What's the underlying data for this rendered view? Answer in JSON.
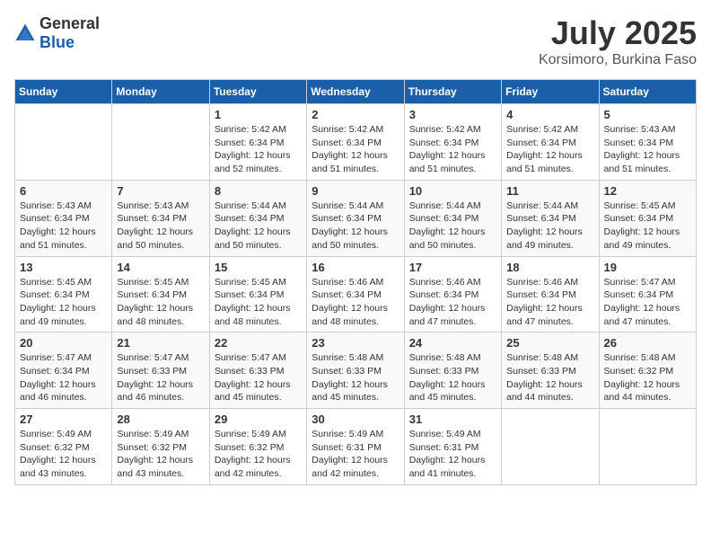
{
  "header": {
    "logo_general": "General",
    "logo_blue": "Blue",
    "month": "July 2025",
    "location": "Korsimoro, Burkina Faso"
  },
  "days_of_week": [
    "Sunday",
    "Monday",
    "Tuesday",
    "Wednesday",
    "Thursday",
    "Friday",
    "Saturday"
  ],
  "weeks": [
    [
      {
        "day": "",
        "sunrise": "",
        "sunset": "",
        "daylight": ""
      },
      {
        "day": "",
        "sunrise": "",
        "sunset": "",
        "daylight": ""
      },
      {
        "day": "1",
        "sunrise": "Sunrise: 5:42 AM",
        "sunset": "Sunset: 6:34 PM",
        "daylight": "Daylight: 12 hours and 52 minutes."
      },
      {
        "day": "2",
        "sunrise": "Sunrise: 5:42 AM",
        "sunset": "Sunset: 6:34 PM",
        "daylight": "Daylight: 12 hours and 51 minutes."
      },
      {
        "day": "3",
        "sunrise": "Sunrise: 5:42 AM",
        "sunset": "Sunset: 6:34 PM",
        "daylight": "Daylight: 12 hours and 51 minutes."
      },
      {
        "day": "4",
        "sunrise": "Sunrise: 5:42 AM",
        "sunset": "Sunset: 6:34 PM",
        "daylight": "Daylight: 12 hours and 51 minutes."
      },
      {
        "day": "5",
        "sunrise": "Sunrise: 5:43 AM",
        "sunset": "Sunset: 6:34 PM",
        "daylight": "Daylight: 12 hours and 51 minutes."
      }
    ],
    [
      {
        "day": "6",
        "sunrise": "Sunrise: 5:43 AM",
        "sunset": "Sunset: 6:34 PM",
        "daylight": "Daylight: 12 hours and 51 minutes."
      },
      {
        "day": "7",
        "sunrise": "Sunrise: 5:43 AM",
        "sunset": "Sunset: 6:34 PM",
        "daylight": "Daylight: 12 hours and 50 minutes."
      },
      {
        "day": "8",
        "sunrise": "Sunrise: 5:44 AM",
        "sunset": "Sunset: 6:34 PM",
        "daylight": "Daylight: 12 hours and 50 minutes."
      },
      {
        "day": "9",
        "sunrise": "Sunrise: 5:44 AM",
        "sunset": "Sunset: 6:34 PM",
        "daylight": "Daylight: 12 hours and 50 minutes."
      },
      {
        "day": "10",
        "sunrise": "Sunrise: 5:44 AM",
        "sunset": "Sunset: 6:34 PM",
        "daylight": "Daylight: 12 hours and 50 minutes."
      },
      {
        "day": "11",
        "sunrise": "Sunrise: 5:44 AM",
        "sunset": "Sunset: 6:34 PM",
        "daylight": "Daylight: 12 hours and 49 minutes."
      },
      {
        "day": "12",
        "sunrise": "Sunrise: 5:45 AM",
        "sunset": "Sunset: 6:34 PM",
        "daylight": "Daylight: 12 hours and 49 minutes."
      }
    ],
    [
      {
        "day": "13",
        "sunrise": "Sunrise: 5:45 AM",
        "sunset": "Sunset: 6:34 PM",
        "daylight": "Daylight: 12 hours and 49 minutes."
      },
      {
        "day": "14",
        "sunrise": "Sunrise: 5:45 AM",
        "sunset": "Sunset: 6:34 PM",
        "daylight": "Daylight: 12 hours and 48 minutes."
      },
      {
        "day": "15",
        "sunrise": "Sunrise: 5:45 AM",
        "sunset": "Sunset: 6:34 PM",
        "daylight": "Daylight: 12 hours and 48 minutes."
      },
      {
        "day": "16",
        "sunrise": "Sunrise: 5:46 AM",
        "sunset": "Sunset: 6:34 PM",
        "daylight": "Daylight: 12 hours and 48 minutes."
      },
      {
        "day": "17",
        "sunrise": "Sunrise: 5:46 AM",
        "sunset": "Sunset: 6:34 PM",
        "daylight": "Daylight: 12 hours and 47 minutes."
      },
      {
        "day": "18",
        "sunrise": "Sunrise: 5:46 AM",
        "sunset": "Sunset: 6:34 PM",
        "daylight": "Daylight: 12 hours and 47 minutes."
      },
      {
        "day": "19",
        "sunrise": "Sunrise: 5:47 AM",
        "sunset": "Sunset: 6:34 PM",
        "daylight": "Daylight: 12 hours and 47 minutes."
      }
    ],
    [
      {
        "day": "20",
        "sunrise": "Sunrise: 5:47 AM",
        "sunset": "Sunset: 6:34 PM",
        "daylight": "Daylight: 12 hours and 46 minutes."
      },
      {
        "day": "21",
        "sunrise": "Sunrise: 5:47 AM",
        "sunset": "Sunset: 6:33 PM",
        "daylight": "Daylight: 12 hours and 46 minutes."
      },
      {
        "day": "22",
        "sunrise": "Sunrise: 5:47 AM",
        "sunset": "Sunset: 6:33 PM",
        "daylight": "Daylight: 12 hours and 45 minutes."
      },
      {
        "day": "23",
        "sunrise": "Sunrise: 5:48 AM",
        "sunset": "Sunset: 6:33 PM",
        "daylight": "Daylight: 12 hours and 45 minutes."
      },
      {
        "day": "24",
        "sunrise": "Sunrise: 5:48 AM",
        "sunset": "Sunset: 6:33 PM",
        "daylight": "Daylight: 12 hours and 45 minutes."
      },
      {
        "day": "25",
        "sunrise": "Sunrise: 5:48 AM",
        "sunset": "Sunset: 6:33 PM",
        "daylight": "Daylight: 12 hours and 44 minutes."
      },
      {
        "day": "26",
        "sunrise": "Sunrise: 5:48 AM",
        "sunset": "Sunset: 6:32 PM",
        "daylight": "Daylight: 12 hours and 44 minutes."
      }
    ],
    [
      {
        "day": "27",
        "sunrise": "Sunrise: 5:49 AM",
        "sunset": "Sunset: 6:32 PM",
        "daylight": "Daylight: 12 hours and 43 minutes."
      },
      {
        "day": "28",
        "sunrise": "Sunrise: 5:49 AM",
        "sunset": "Sunset: 6:32 PM",
        "daylight": "Daylight: 12 hours and 43 minutes."
      },
      {
        "day": "29",
        "sunrise": "Sunrise: 5:49 AM",
        "sunset": "Sunset: 6:32 PM",
        "daylight": "Daylight: 12 hours and 42 minutes."
      },
      {
        "day": "30",
        "sunrise": "Sunrise: 5:49 AM",
        "sunset": "Sunset: 6:31 PM",
        "daylight": "Daylight: 12 hours and 42 minutes."
      },
      {
        "day": "31",
        "sunrise": "Sunrise: 5:49 AM",
        "sunset": "Sunset: 6:31 PM",
        "daylight": "Daylight: 12 hours and 41 minutes."
      },
      {
        "day": "",
        "sunrise": "",
        "sunset": "",
        "daylight": ""
      },
      {
        "day": "",
        "sunrise": "",
        "sunset": "",
        "daylight": ""
      }
    ]
  ]
}
